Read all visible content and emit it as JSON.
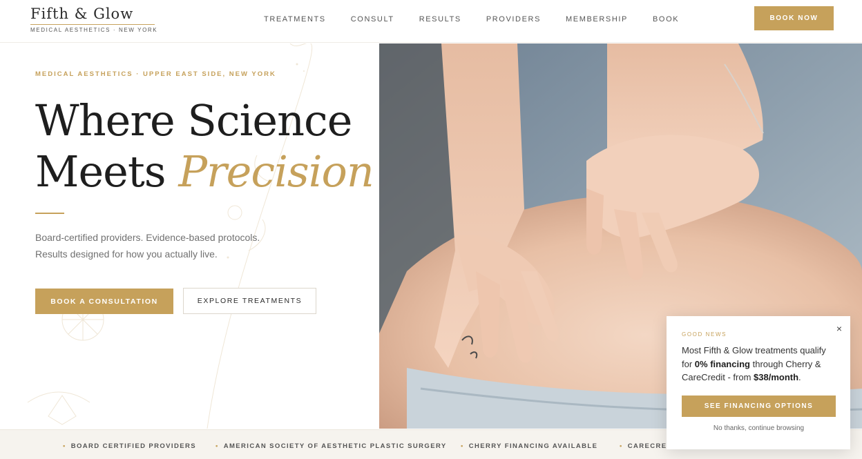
{
  "brand": {
    "name": "Fifth & Glow",
    "tagline": "MEDICAL AESTHETICS · NEW YORK"
  },
  "nav": {
    "items": [
      "TREATMENTS",
      "CONSULT",
      "RESULTS",
      "PROVIDERS",
      "MEMBERSHIP",
      "BOOK"
    ],
    "cta": "BOOK NOW"
  },
  "hero": {
    "eyebrow": "MEDICAL AESTHETICS · UPPER EAST SIDE, NEW YORK",
    "headline_line1": "Where Science",
    "headline_line2_plain": "Meets ",
    "headline_line2_accent": "Precision",
    "subcopy_line1": "Board-certified providers. Evidence-based protocols.",
    "subcopy_line2": "Results designed for how you actually live.",
    "primary_cta": "BOOK A CONSULTATION",
    "secondary_cta": "EXPLORE TREATMENTS"
  },
  "trust_bar": {
    "items": [
      "BOARD CERTIFIED PROVIDERS",
      "AMERICAN SOCIETY OF AESTHETIC PLASTIC SURGERY",
      "CHERRY FINANCING AVAILABLE",
      "CARECREDIT"
    ]
  },
  "popup": {
    "eyebrow": "GOOD NEWS",
    "body_part1": "Most Fifth & Glow treatments qualify for ",
    "body_bold1": "0% financing",
    "body_part2": " through Cherry & CareCredit - from ",
    "body_bold2": "$38/month",
    "body_part3": ".",
    "cta": "SEE FINANCING OPTIONS",
    "dismiss": "No thanks, continue browsing",
    "close": "×"
  },
  "colors": {
    "accent": "#c6a15b",
    "text": "#2a2a2a",
    "muted": "#707070",
    "trust_bg": "#f6f3ee"
  }
}
